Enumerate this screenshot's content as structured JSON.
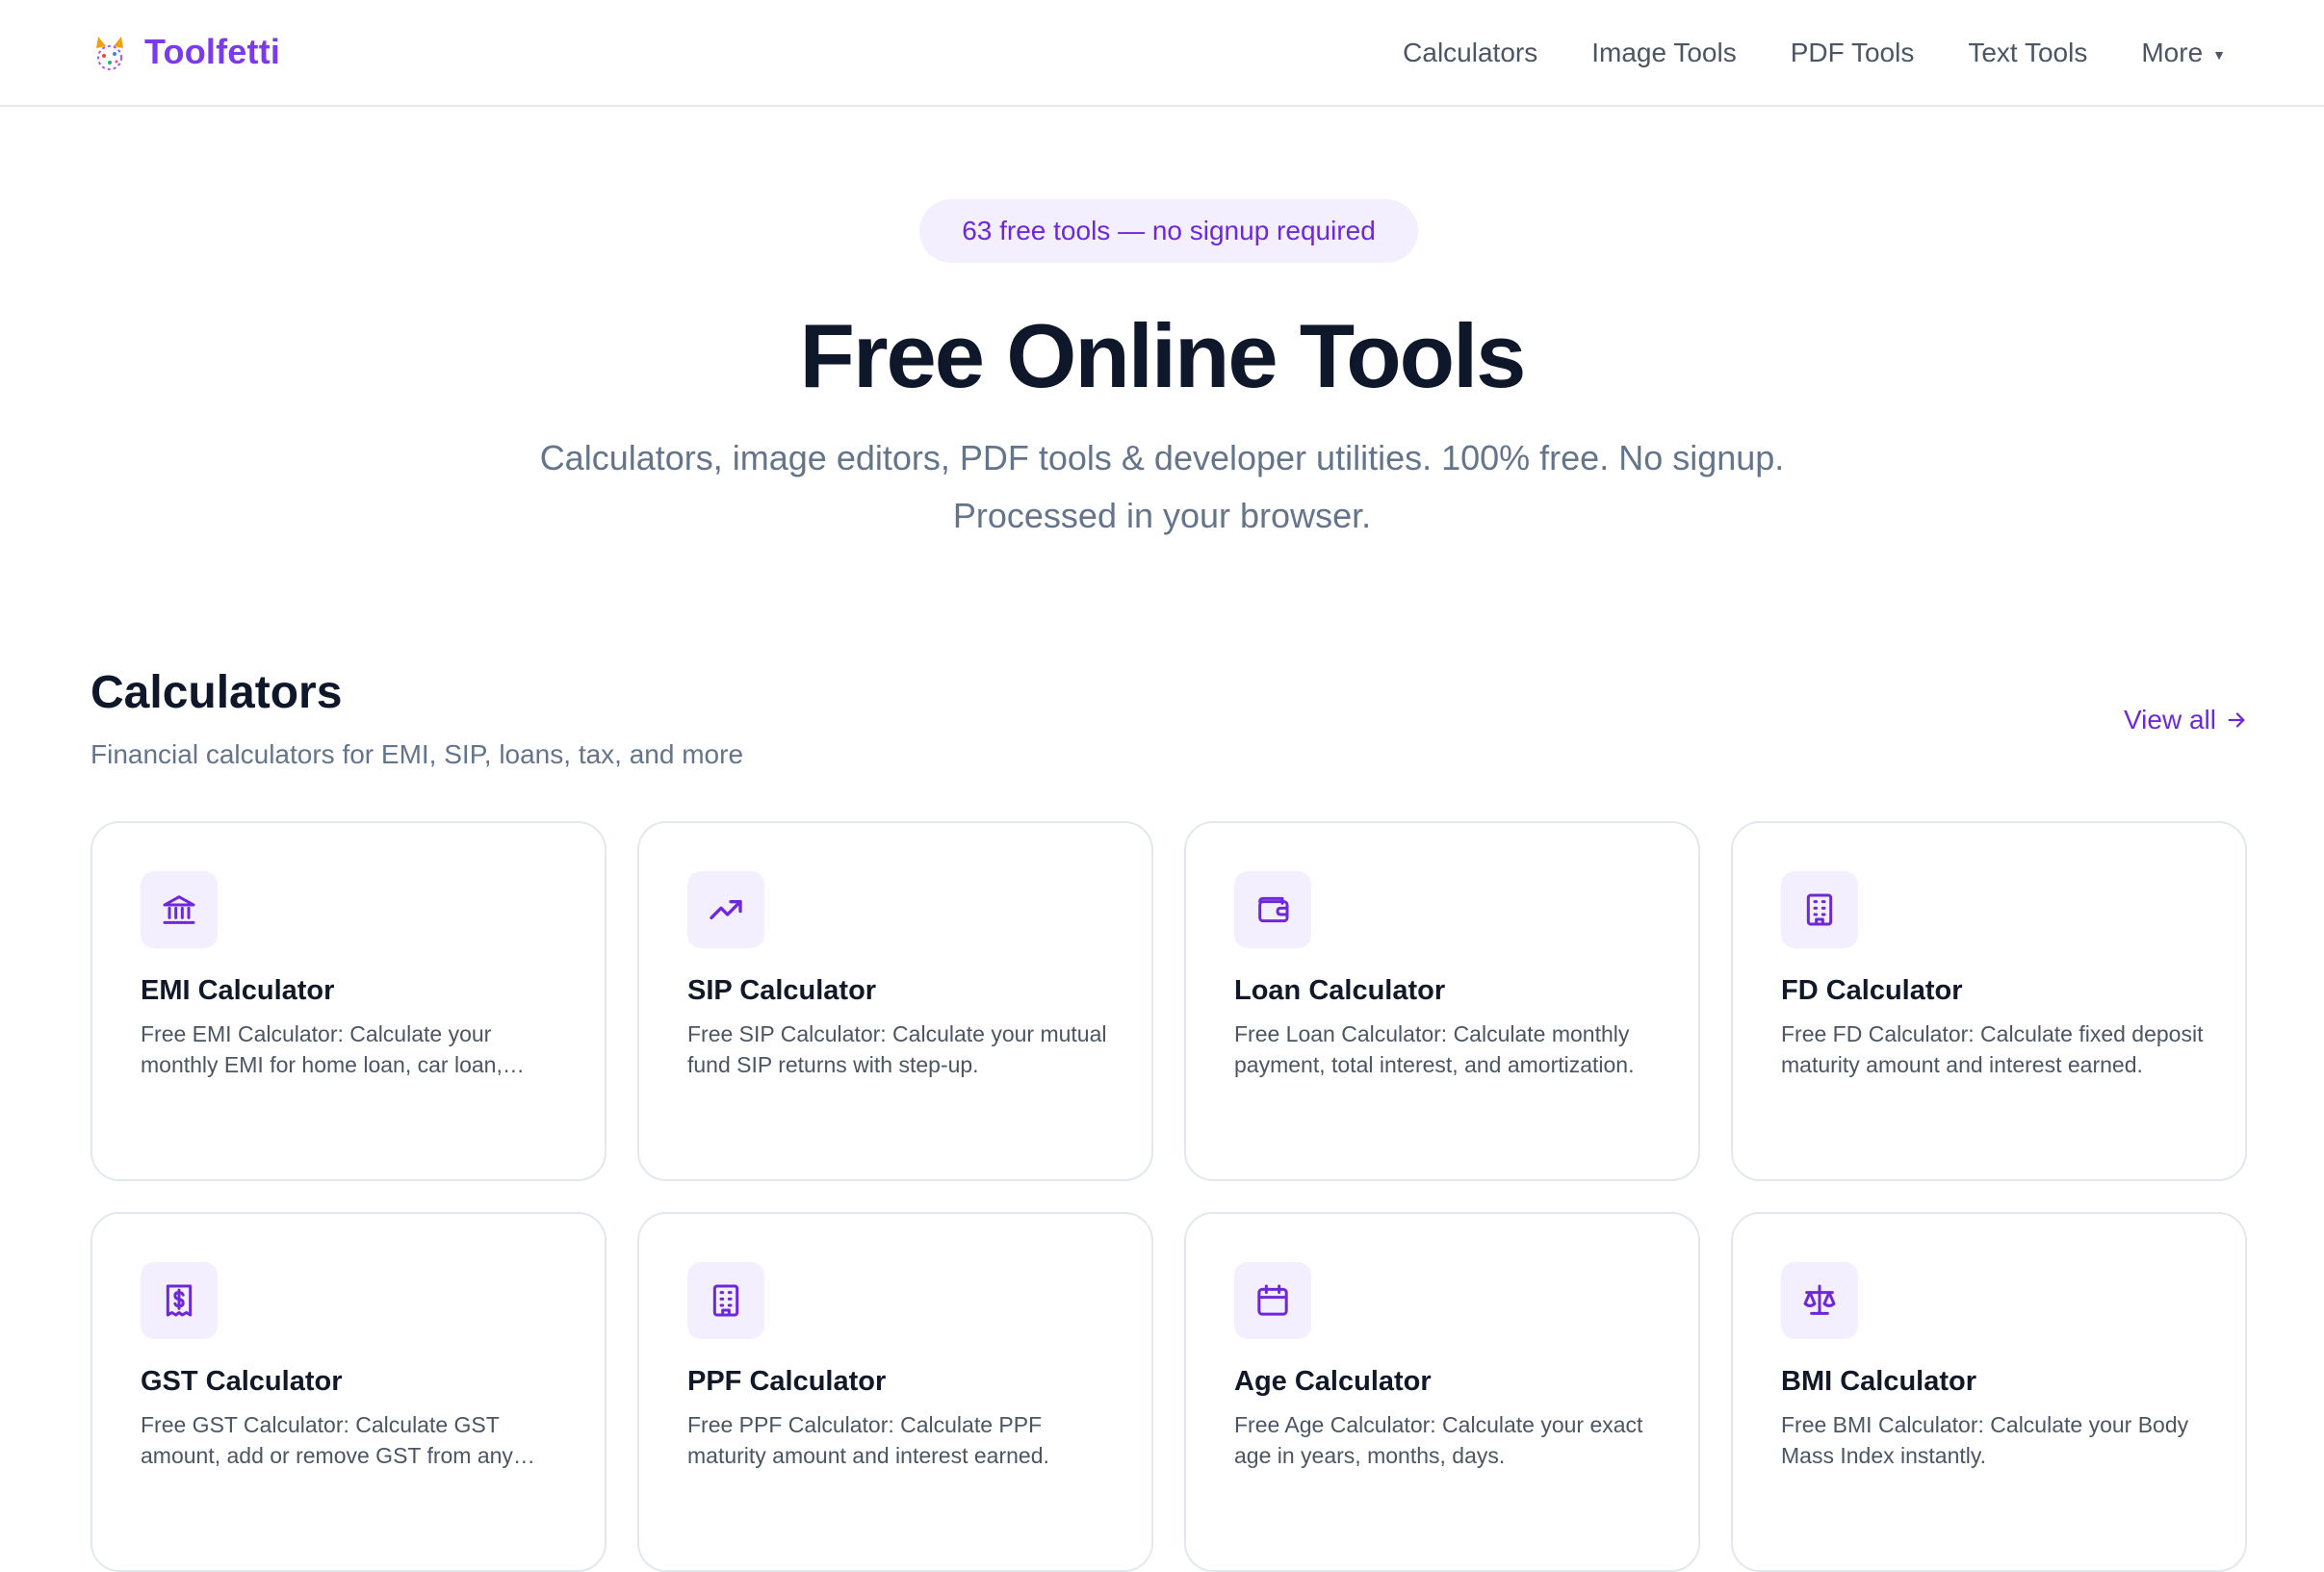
{
  "brand": {
    "name": "Toolfetti"
  },
  "nav": {
    "items": [
      "Calculators",
      "Image Tools",
      "PDF Tools",
      "Text Tools"
    ],
    "more_label": "More"
  },
  "hero": {
    "badge": "63 free tools — no signup required",
    "title": "Free Online Tools",
    "subtitle_line1": "Calculators, image editors, PDF tools & developer utilities. 100% free. No signup.",
    "subtitle_line2": "Processed in your browser."
  },
  "section": {
    "title": "Calculators",
    "description": "Financial calculators for EMI, SIP, loans, tax, and more",
    "view_all": "View all"
  },
  "cards": [
    {
      "title": "EMI Calculator",
      "desc": "Free EMI Calculator: Calculate your monthly EMI for home loan, car loan, personal loan.",
      "icon": "bank-icon"
    },
    {
      "title": "SIP Calculator",
      "desc": "Free SIP Calculator: Calculate your mutual fund SIP returns with step-up.",
      "icon": "trending-up-icon"
    },
    {
      "title": "Loan Calculator",
      "desc": "Free Loan Calculator: Calculate monthly payment, total interest, and amortization.",
      "icon": "wallet-icon"
    },
    {
      "title": "FD Calculator",
      "desc": "Free FD Calculator: Calculate fixed deposit maturity amount and interest earned.",
      "icon": "building-icon"
    },
    {
      "title": "GST Calculator",
      "desc": "Free GST Calculator: Calculate GST amount, add or remove GST from any amount.",
      "icon": "receipt-icon"
    },
    {
      "title": "PPF Calculator",
      "desc": "Free PPF Calculator: Calculate PPF maturity amount and interest earned.",
      "icon": "building-icon"
    },
    {
      "title": "Age Calculator",
      "desc": "Free Age Calculator: Calculate your exact age in years, months, days.",
      "icon": "calendar-icon"
    },
    {
      "title": "BMI Calculator",
      "desc": "Free BMI Calculator: Calculate your Body Mass Index instantly.",
      "icon": "scale-icon"
    }
  ],
  "colors": {
    "accent": "#7c3aed",
    "accent_soft": "#f3effe",
    "text": "#0f172a",
    "muted": "#64748b"
  }
}
